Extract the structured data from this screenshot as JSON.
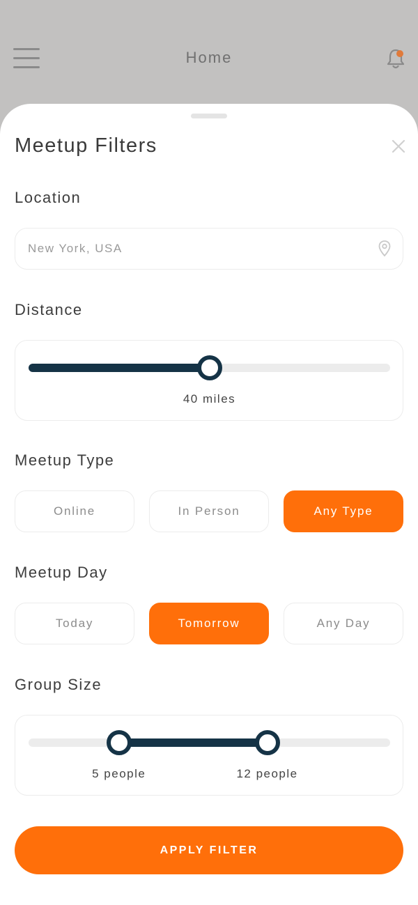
{
  "header": {
    "title": "Home",
    "menu_icon": "hamburger-menu-icon",
    "notification_icon": "bell-icon",
    "notification_dot_color": "#e07a3a"
  },
  "sheet": {
    "title": "Meetup Filters",
    "close_icon": "close-icon"
  },
  "location": {
    "label": "Location",
    "value": "",
    "placeholder": "New York, USA",
    "icon": "map-pin-icon"
  },
  "distance": {
    "label": "Distance",
    "value_label": "40 miles",
    "fraction": 0.5
  },
  "meetup_type": {
    "label": "Meetup Type",
    "options": [
      "Online",
      "In Person",
      "Any Type"
    ],
    "selected": "Any Type"
  },
  "meetup_day": {
    "label": "Meetup Day",
    "options": [
      "Today",
      "Tomorrow",
      "Any Day"
    ],
    "selected": "Tomorrow"
  },
  "group_size": {
    "label": "Group Size",
    "min_label": "5 people",
    "max_label": "12 people",
    "min_fraction": 0.25,
    "max_fraction": 0.66
  },
  "apply_button": {
    "label": "APPLY FILTER"
  },
  "colors": {
    "accent": "#ff6f0a",
    "slider": "#153346",
    "overlay": "#c2c1c0"
  }
}
